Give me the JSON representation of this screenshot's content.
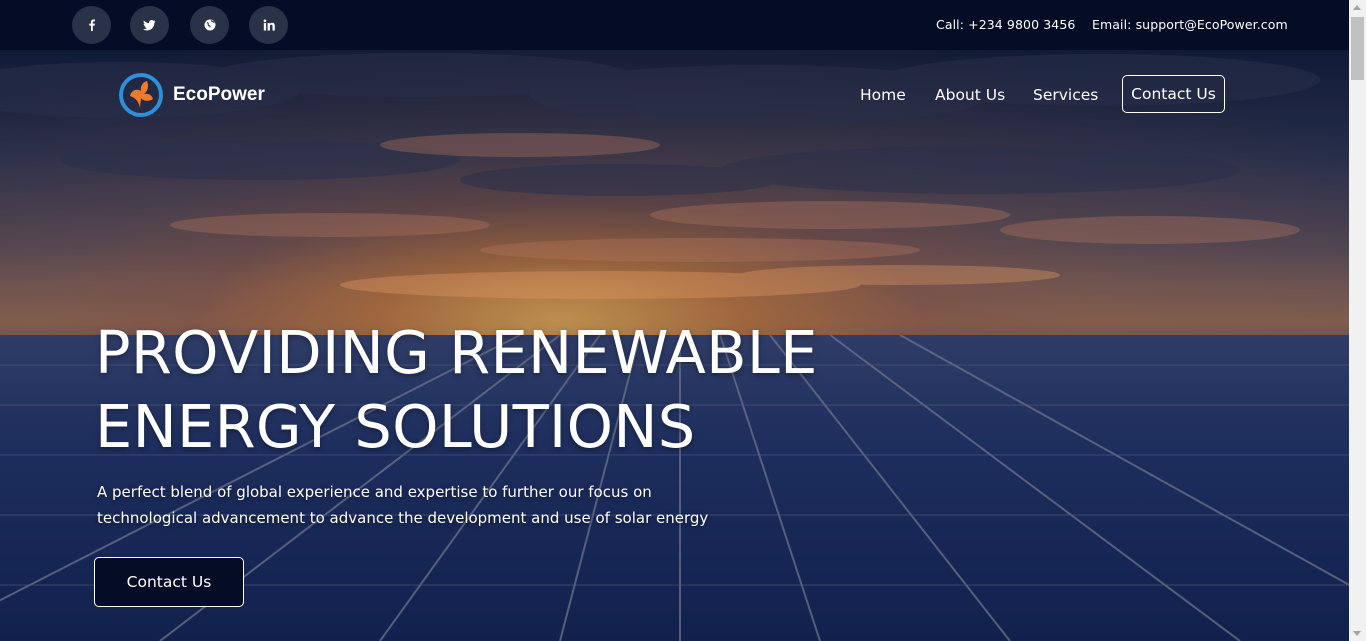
{
  "topbar": {
    "social": [
      {
        "name": "facebook-icon"
      },
      {
        "name": "twitter-icon"
      },
      {
        "name": "globe-icon"
      },
      {
        "name": "linkedin-icon"
      }
    ],
    "call": "Call: +234 9800 3456",
    "email": "Email: support@EcoPower.com"
  },
  "brand": {
    "name": "EcoPower",
    "logo_icon": "leaf-logo-icon",
    "logo_colors": {
      "ring": "#2f8fd8",
      "leaf": "#f07a2b"
    }
  },
  "nav": {
    "home": "Home",
    "about": "About Us",
    "services": "Services",
    "contact": "Contact Us"
  },
  "hero": {
    "headline_line1": "PROVIDING RENEWABLE",
    "headline_line2": "ENERGY SOLUTIONS",
    "subtext_line1": "A perfect blend of global experience and expertise to further our focus on",
    "subtext_line2": "technological advancement to advance the development and use of solar energy",
    "cta": "Contact Us"
  },
  "colors": {
    "navy": "#050d26",
    "social_bg": "#2a3248"
  }
}
